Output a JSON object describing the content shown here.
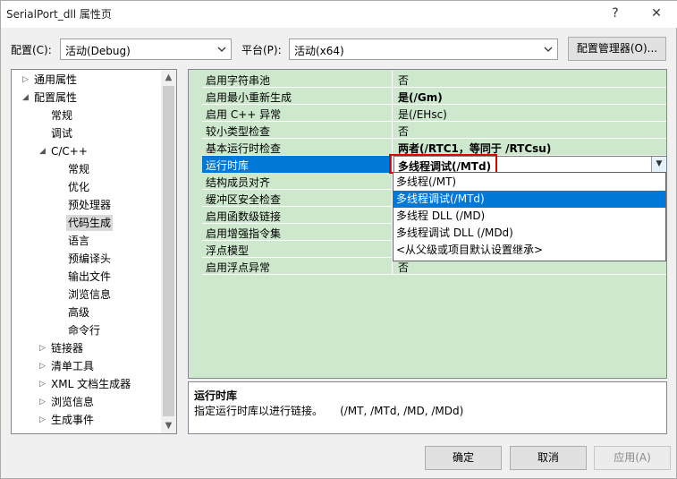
{
  "window": {
    "title": "SerialPort_dll 属性页",
    "help": "?",
    "close": "✕"
  },
  "config": {
    "config_label": "配置(C):",
    "config_value": "活动(Debug)",
    "platform_label": "平台(P):",
    "platform_value": "活动(x64)",
    "manager_button": "配置管理器(O)..."
  },
  "tree": {
    "items": [
      {
        "label": "通用属性",
        "toggle": "▷"
      },
      {
        "label": "配置属性",
        "toggle": "◢"
      },
      {
        "label": "常规"
      },
      {
        "label": "调试"
      },
      {
        "label": "C/C++",
        "toggle": "◢"
      },
      {
        "label": "常规"
      },
      {
        "label": "优化"
      },
      {
        "label": "预处理器"
      },
      {
        "label": "代码生成",
        "selected": true
      },
      {
        "label": "语言"
      },
      {
        "label": "预编译头"
      },
      {
        "label": "输出文件"
      },
      {
        "label": "浏览信息"
      },
      {
        "label": "高级"
      },
      {
        "label": "命令行"
      },
      {
        "label": "链接器",
        "toggle": "▷"
      },
      {
        "label": "清单工具",
        "toggle": "▷"
      },
      {
        "label": "XML 文档生成器",
        "toggle": "▷"
      },
      {
        "label": "浏览信息",
        "toggle": "▷"
      },
      {
        "label": "生成事件",
        "toggle": "▷"
      }
    ]
  },
  "grid": {
    "rows": [
      {
        "name": "启用字符串池",
        "value": "否"
      },
      {
        "name": "启用最小重新生成",
        "value": "是(/Gm)",
        "bold": true
      },
      {
        "name": "启用 C++ 异常",
        "value": "是(/EHsc)"
      },
      {
        "name": "较小类型检查",
        "value": "否"
      },
      {
        "name": "基本运行时检查",
        "value": "两者(/RTC1，等同于 /RTCsu)",
        "bold": true
      },
      {
        "name": "运行时库",
        "value": "多线程调试(/MTd)",
        "selected": true
      },
      {
        "name": "结构成员对齐",
        "value": ""
      },
      {
        "name": "缓冲区安全检查",
        "value": ""
      },
      {
        "name": "启用函数级链接",
        "value": ""
      },
      {
        "name": "启用增强指令集",
        "value": ""
      },
      {
        "name": "浮点模型",
        "value": ""
      },
      {
        "name": "启用浮点异常",
        "value": "否"
      }
    ]
  },
  "dropdown": {
    "options": [
      {
        "label": "多线程(/MT)"
      },
      {
        "label": "多线程调试(/MTd)",
        "selected": true
      },
      {
        "label": "多线程 DLL (/MD)"
      },
      {
        "label": "多线程调试 DLL (/MDd)"
      },
      {
        "label": "<从父级或项目默认设置继承>"
      }
    ]
  },
  "description": {
    "title": "运行时库",
    "text": "指定运行时库以进行链接。     (/MT, /MTd, /MD, /MDd)"
  },
  "buttons": {
    "ok": "确定",
    "cancel": "取消",
    "apply": "应用(A)"
  },
  "colors": {
    "grid_bg": "#cde8cd",
    "selection": "#0078d7",
    "highlight_box": "#e00000"
  }
}
